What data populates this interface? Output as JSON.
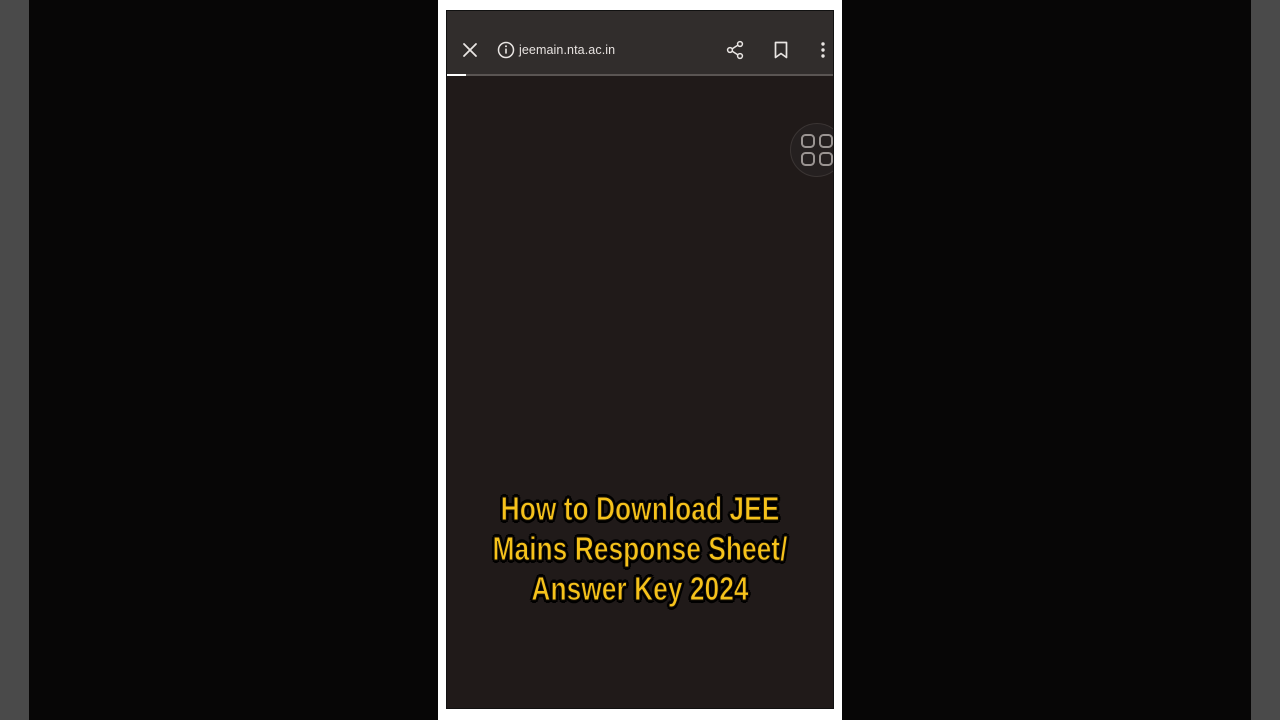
{
  "browser": {
    "url": "jeemain.nta.ac.in",
    "load_progress_percent": 5,
    "icons": {
      "close": "close-icon",
      "site_info": "info-icon",
      "share": "share-icon",
      "bookmark": "bookmark-icon",
      "menu": "more-vert-icon",
      "overlay": "grid-apps-icon"
    }
  },
  "caption": {
    "lines": [
      "How to Download JEE",
      "Mains Response Sheet/",
      "Answer Key 2024"
    ]
  },
  "colors": {
    "caption": "#f5c21b",
    "toolbar": "#312d2c",
    "page_bg": "#201a19"
  }
}
